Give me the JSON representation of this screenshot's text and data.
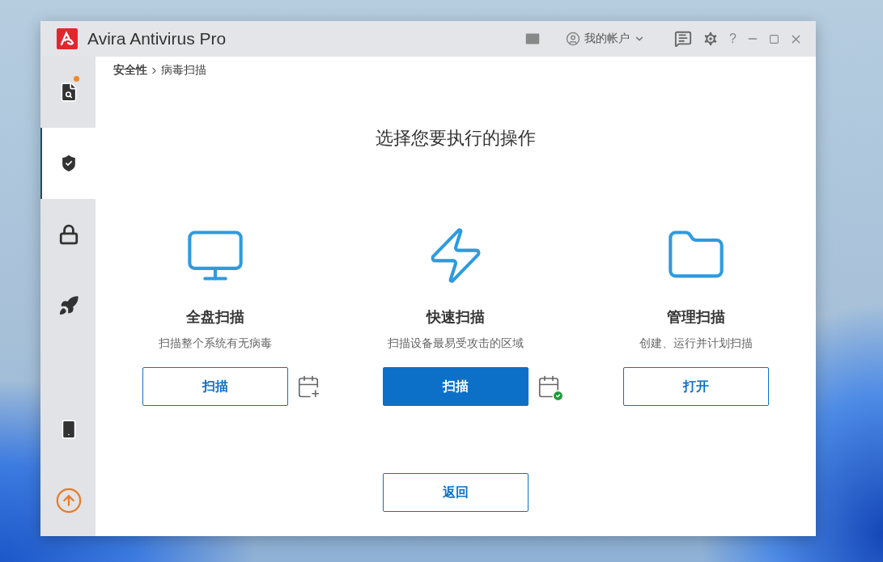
{
  "window": {
    "title": "Avira Antivirus Pro"
  },
  "header": {
    "account": "我的帐户",
    "help": "?"
  },
  "sidebar": {
    "items": [
      {
        "kind": "scan",
        "selected": false,
        "badge": true
      },
      {
        "kind": "security",
        "selected": true,
        "badge": false
      },
      {
        "kind": "privacy",
        "selected": false,
        "badge": false
      },
      {
        "kind": "performance",
        "selected": false,
        "badge": false
      }
    ],
    "bottom": [
      {
        "kind": "mobile"
      },
      {
        "kind": "upgrade"
      }
    ]
  },
  "breadcrumb": [
    "安全性",
    "病毒扫描"
  ],
  "heading": "选择您要执行的操作",
  "scans": [
    {
      "kind": "monitor",
      "title": "全盘扫描",
      "description": "扫描整个系统有无病毒",
      "button": "扫描",
      "primary": false,
      "schedulable": true,
      "scheduled": false
    },
    {
      "kind": "bolt",
      "title": "快速扫描",
      "description": "扫描设备最易受攻击的区域",
      "button": "扫描",
      "primary": true,
      "schedulable": true,
      "scheduled": true
    },
    {
      "kind": "folder",
      "title": "管理扫描",
      "description": "创建、运行并计划扫描",
      "button": "打开",
      "primary": false,
      "schedulable": false
    }
  ],
  "back": "返回"
}
